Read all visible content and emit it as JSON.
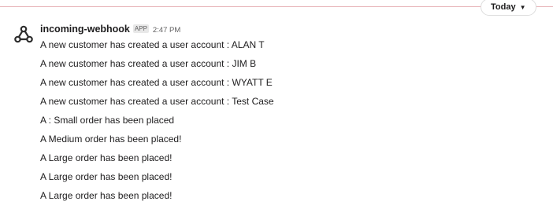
{
  "date_divider": {
    "label": "Today"
  },
  "message": {
    "sender": "incoming-webhook",
    "badge": "APP",
    "timestamp": "2:47 PM",
    "avatar_icon": "webhook-icon",
    "lines": [
      "A new customer has created a user account : ALAN T",
      "A new customer has created a user account : JIM B",
      "A new customer has created a user account : WYATT E",
      "A new customer has created a user account : Test Case",
      "A : Small order has been placed",
      "A Medium order has been placed!",
      "A Large order has been placed!",
      "A Large order has been placed!",
      "A Large order has been placed!"
    ]
  },
  "colors": {
    "divider": "#e8b4b8",
    "text": "#1d1c1d",
    "muted": "#616061"
  }
}
